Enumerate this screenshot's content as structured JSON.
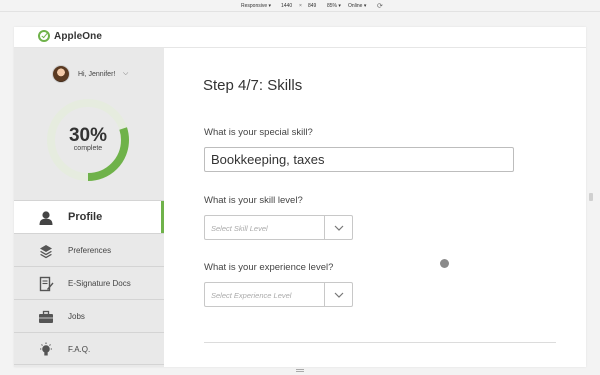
{
  "devtools": {
    "device": "Responsive ▾",
    "width": "1440",
    "x": "×",
    "height": "849",
    "zoom": "85% ▾",
    "network": "Online ▾",
    "rotate_icon": "rotate-icon"
  },
  "header": {
    "app_name": "AppleOne",
    "logo_icon": "check-circle-icon"
  },
  "sidebar": {
    "greeting": "Hi, Jennifer!",
    "progress": {
      "percent_text": "30%",
      "label": "complete",
      "value": 0.3
    },
    "nav_items": [
      {
        "label": "Profile",
        "icon": "person-icon",
        "active": true
      },
      {
        "label": "Preferences",
        "icon": "layers-icon",
        "active": false
      },
      {
        "label": "E-Signature Docs",
        "icon": "document-sign-icon",
        "active": false
      },
      {
        "label": "Jobs",
        "icon": "briefcase-icon",
        "active": false
      },
      {
        "label": "F.A.Q.",
        "icon": "lightbulb-icon",
        "active": false
      }
    ]
  },
  "main": {
    "step_title": "Step 4/7: Skills",
    "special_skill": {
      "question": "What is your special skill?",
      "value": "Bookkeeping, taxes"
    },
    "skill_level": {
      "question": "What is your skill level?",
      "placeholder": "Select Skill Level"
    },
    "experience_level": {
      "question": "What is your experience level?",
      "placeholder": "Select Experience Level"
    }
  },
  "colors": {
    "accent": "#6fb24a",
    "sidebar_bg": "#e9e9e9",
    "ring_track": "#e6ecdf"
  }
}
